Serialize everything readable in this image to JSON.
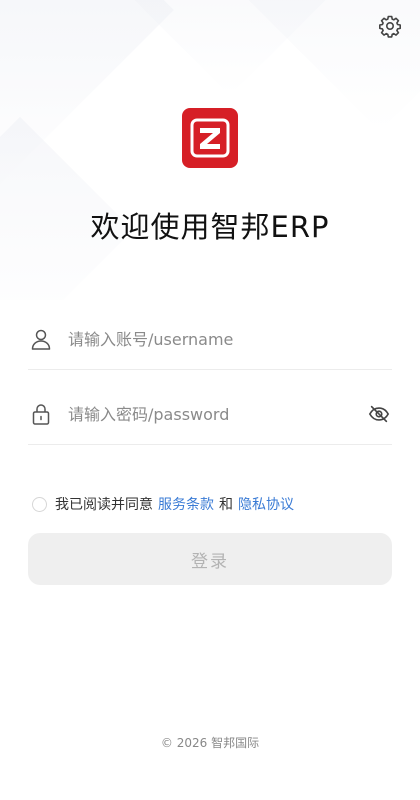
{
  "icons": {
    "settings": "gear-icon",
    "logo": "z-logo",
    "user": "user-icon",
    "lock": "lock-icon",
    "eye": "eye-off-icon"
  },
  "colors": {
    "brand": "#d61f26",
    "link": "#3a7bd5",
    "button_disabled_bg": "#efefef",
    "button_disabled_text": "#b3b3b3"
  },
  "header": {
    "welcome": "欢迎使用智邦ERP"
  },
  "form": {
    "username": {
      "value": "",
      "placeholder": "请输入账号/username"
    },
    "password": {
      "value": "",
      "placeholder": "请输入密码/password"
    },
    "agreement": {
      "text": "我已阅读并同意",
      "terms_link": "服务条款",
      "connector": "和",
      "privacy_link": "隐私协议",
      "checked": false
    },
    "login_label": "登录"
  },
  "footer": {
    "copyright": "© 2026 智邦国际"
  }
}
